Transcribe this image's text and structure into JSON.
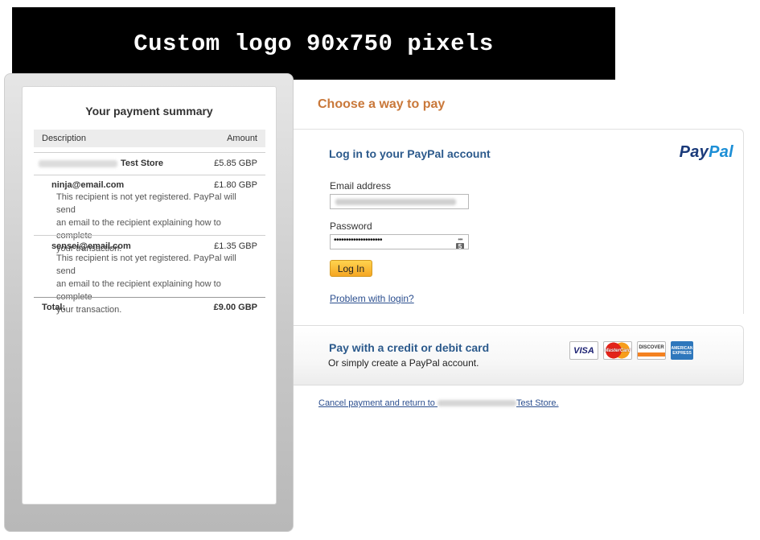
{
  "logo_banner": {
    "text": "Custom logo 90x750 pixels"
  },
  "summary": {
    "title": "Your payment summary",
    "col_description": "Description",
    "col_amount": "Amount",
    "store_row": {
      "name": "Test Store",
      "amount": "£5.85 GBP"
    },
    "recipients": [
      {
        "email": "ninja@email.com",
        "amount": "£1.80 GBP",
        "note_lines": [
          "This recipient is not yet registered. PayPal will send",
          "an email to the recipient explaining how to complete",
          "your transaction."
        ]
      },
      {
        "email": "sensei@email.com",
        "amount": "£1.35 GBP",
        "note_lines": [
          "This recipient is not yet registered. PayPal will send",
          "an email to the recipient explaining how to complete",
          "your transaction."
        ]
      }
    ],
    "total_label": "Total:",
    "total_amount": "£9.00 GBP"
  },
  "choose_heading": "Choose a way to pay",
  "login": {
    "heading": "Log in to your PayPal account",
    "logo_part1": "Pay",
    "logo_part2": "Pal",
    "email_label": "Email address",
    "password_label": "Password",
    "password_value": "••••••••••••••••••••",
    "keyboard_number": "5",
    "login_button": "Log In",
    "problem_link": "Problem with login?"
  },
  "card": {
    "heading": "Pay with a credit or debit card",
    "subtext": "Or simply create a PayPal account.",
    "logos": {
      "visa": "VISA",
      "mastercard": "MasterCard",
      "discover": "DISCOVER",
      "amex": "AMERICAN EXPRESS"
    }
  },
  "cancel": {
    "prefix": "Cancel payment and return to",
    "suffix": "Test Store."
  },
  "colors": {
    "accent_orange": "#c9783a",
    "heading_blue": "#2c5a8c",
    "link_blue": "#2c4f8f",
    "button_yellow": "#ffd34e"
  }
}
